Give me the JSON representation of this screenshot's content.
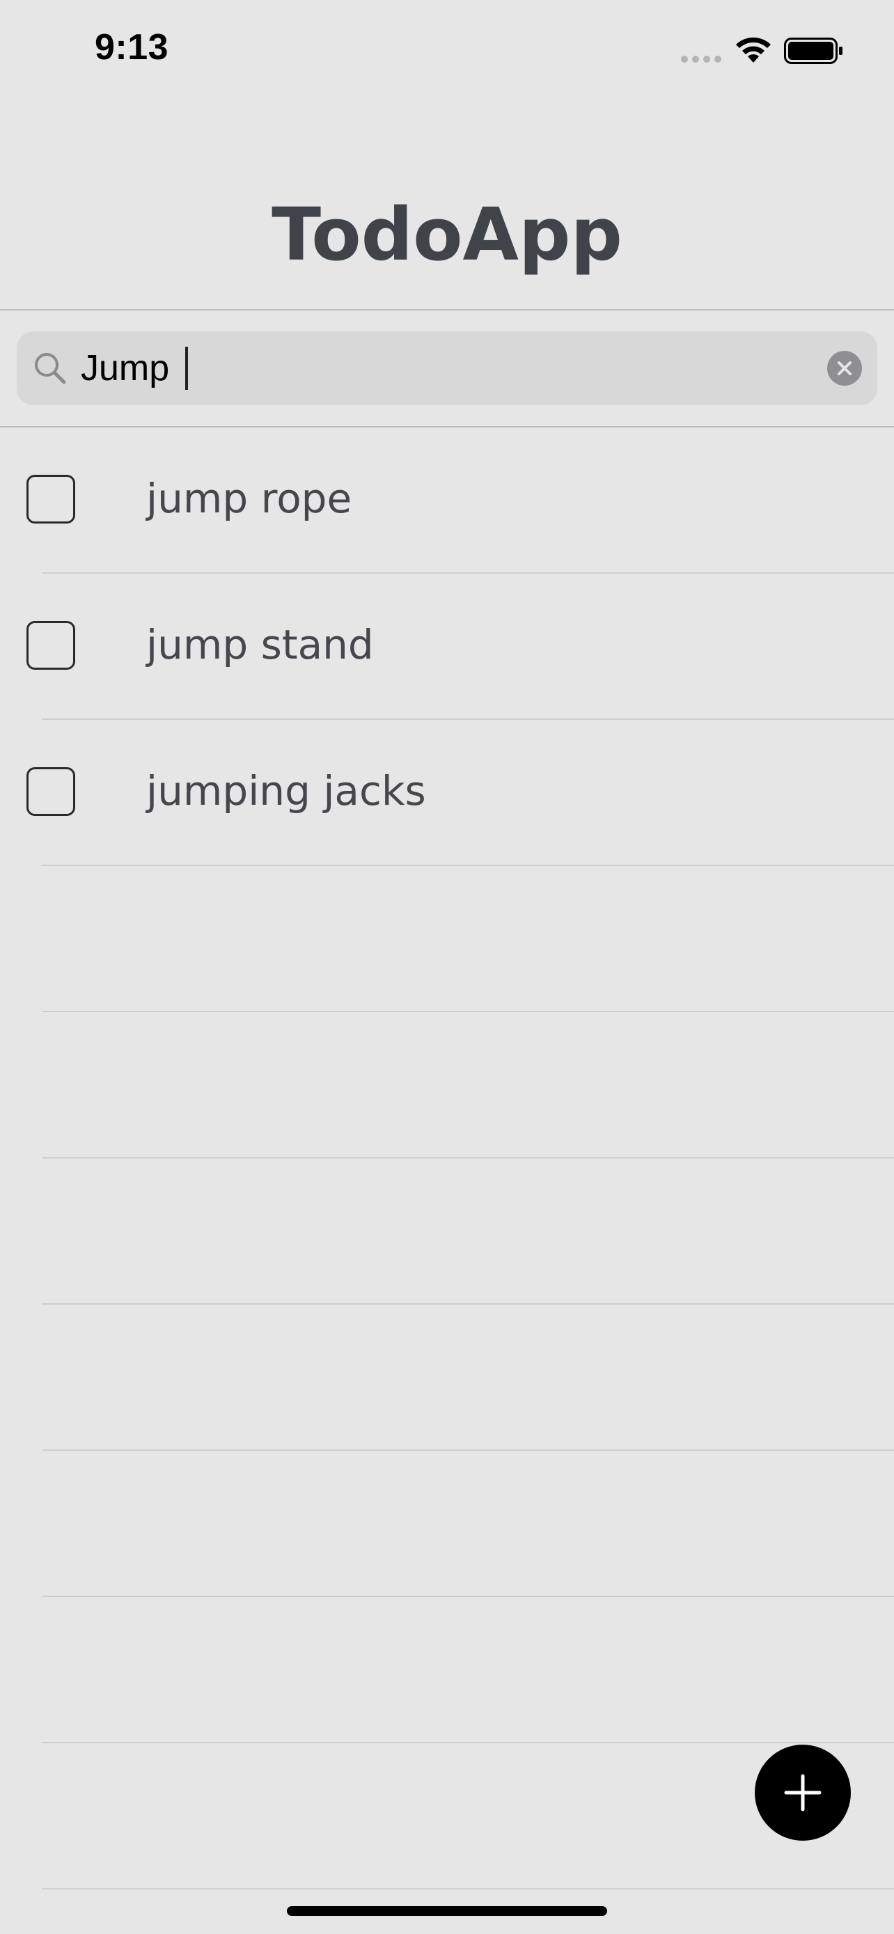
{
  "status_bar": {
    "time": "9:13",
    "icons": [
      "signal-dots-icon",
      "wifi-icon",
      "battery-icon"
    ]
  },
  "header": {
    "title": "TodoApp"
  },
  "search": {
    "value": "Jump",
    "icon": "search-icon",
    "clear_icon": "clear-icon"
  },
  "todos": [
    {
      "label": "jump rope",
      "checked": false
    },
    {
      "label": "jump stand",
      "checked": false
    },
    {
      "label": "jumping jacks",
      "checked": false
    }
  ],
  "fab": {
    "icon": "plus-icon"
  },
  "colors": {
    "background": "#e6e6e6",
    "title": "#404349",
    "text": "#45474d",
    "search_bg": "#d8d8d8",
    "fab": "#000000"
  }
}
